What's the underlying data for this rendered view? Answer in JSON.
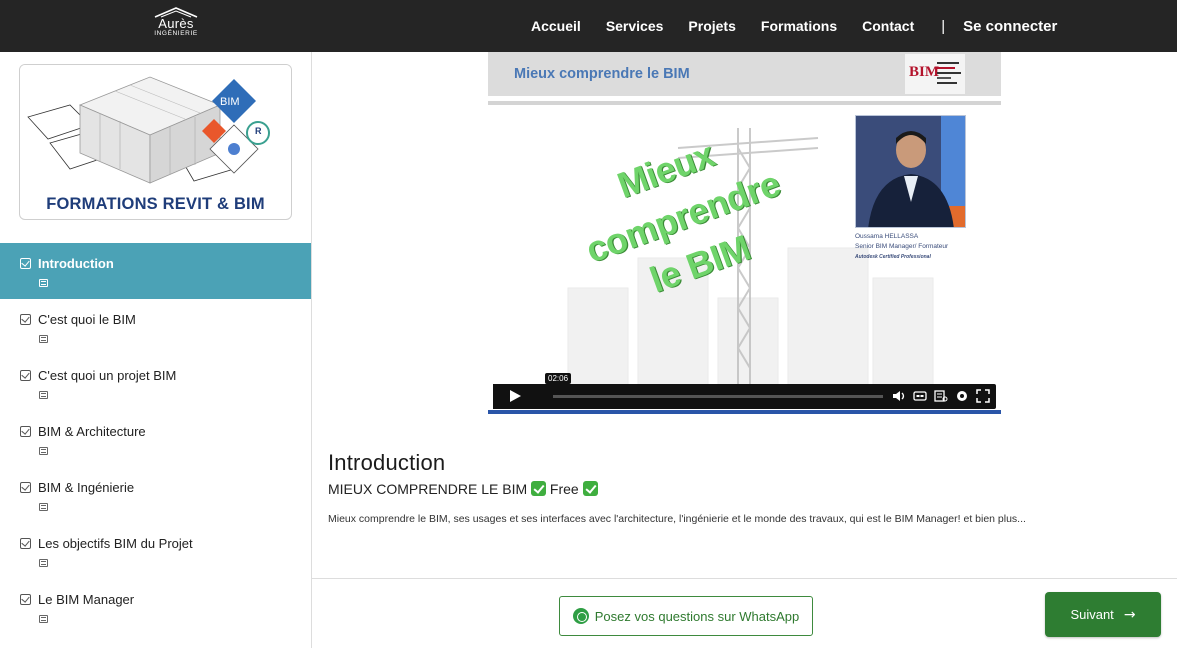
{
  "brand": {
    "name": "Aurès",
    "sub": "INGÉNIERIE"
  },
  "nav": {
    "items": [
      "Accueil",
      "Services",
      "Projets",
      "Formations",
      "Contact"
    ],
    "separator": "|",
    "login": "Se connecter"
  },
  "sidebar": {
    "card_caption": "FORMATIONS REVIT & BIM",
    "card_badge": "BIM",
    "card_badge_r": "R",
    "lessons": [
      {
        "label": "Introduction",
        "active": true
      },
      {
        "label": "C'est quoi le BIM",
        "active": false
      },
      {
        "label": "C'est quoi un projet BIM",
        "active": false
      },
      {
        "label": "BIM & Architecture",
        "active": false
      },
      {
        "label": "BIM & Ingénierie",
        "active": false
      },
      {
        "label": "Les objectifs BIM du Projet",
        "active": false
      },
      {
        "label": "Le BIM Manager",
        "active": false
      }
    ]
  },
  "video": {
    "slide_title": "Mieux comprendre le BIM",
    "badge_text": "BIM",
    "overlay_line1": "Mieux comprendre",
    "overlay_line2": "le BIM",
    "speaker_name": "Oussama HELLASSA",
    "speaker_role": "Senior BIM Manager/ Formateur",
    "speaker_cert": "Autodesk Certified Professional",
    "time": "02:06",
    "icons": [
      "volume-icon",
      "captions-icon",
      "transcript-icon",
      "settings-icon",
      "fullscreen-icon"
    ]
  },
  "lesson": {
    "title": "Introduction",
    "subtitle_text": "MIEUX COMPRENDRE LE BIM",
    "subtitle_free": "Free",
    "description": "Mieux comprendre le BIM, ses usages et ses interfaces avec l'architecture, l'ingénierie et le monde des travaux, qui est le BIM Manager! et bien plus..."
  },
  "footer": {
    "whatsapp_label": "Posez vos questions sur WhatsApp",
    "next_label": "Suivant",
    "next_arrow": "→"
  },
  "colors": {
    "topbar": "#252525",
    "active": "#4ba2b6",
    "green": "#2e7d32",
    "slide_title": "#4a78b5"
  }
}
